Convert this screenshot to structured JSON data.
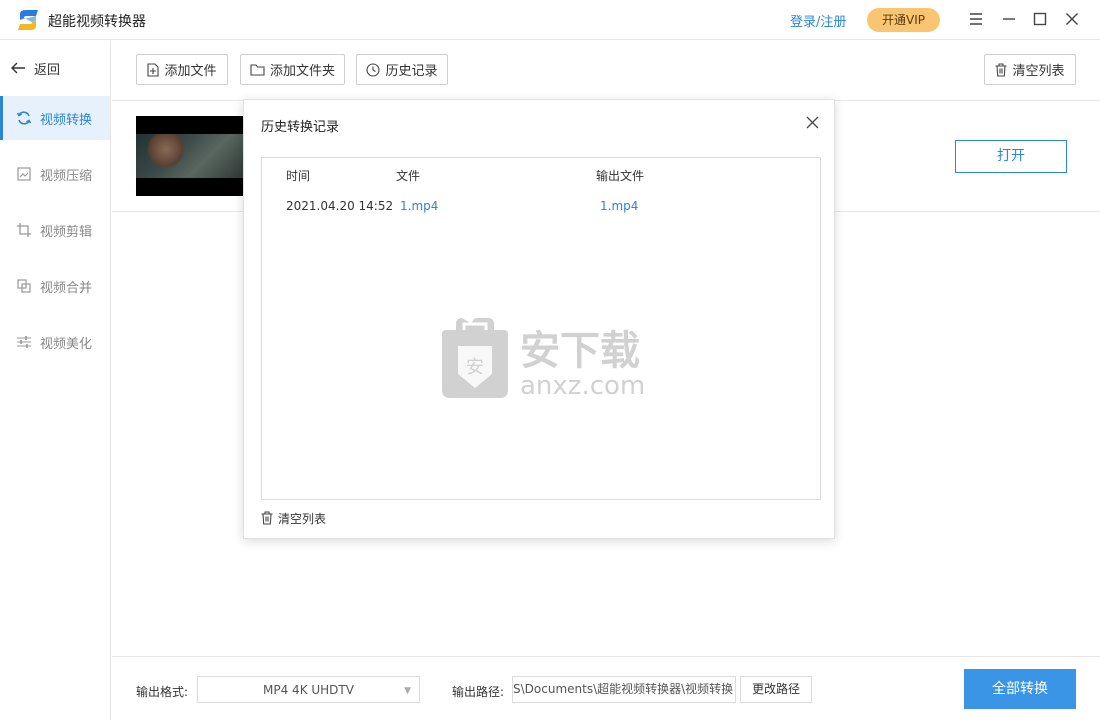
{
  "app": {
    "title": "超能视频转换器",
    "login_label": "登录/注册",
    "vip_label": "开通VIP"
  },
  "sidebar": {
    "back_label": "返回",
    "items": [
      {
        "label": "视频转换",
        "icon": "refresh-icon",
        "active": true
      },
      {
        "label": "视频压缩",
        "icon": "compress-icon",
        "active": false
      },
      {
        "label": "视频剪辑",
        "icon": "crop-icon",
        "active": false
      },
      {
        "label": "视频合并",
        "icon": "merge-icon",
        "active": false
      },
      {
        "label": "视频美化",
        "icon": "sliders-icon",
        "active": false
      }
    ]
  },
  "toolbar": {
    "add_file": "添加文件",
    "add_folder": "添加文件夹",
    "history": "历史记录",
    "clear_list": "清空列表"
  },
  "file_row": {
    "open_label": "打开"
  },
  "bottom": {
    "format_label": "输出格式:",
    "format_value": "MP4 4K UHDTV",
    "path_label": "输出路径:",
    "path_value": "S\\Documents\\超能视频转换器\\视频转换",
    "change_path": "更改路径",
    "convert_all": "全部转换"
  },
  "history_dialog": {
    "title": "历史转换记录",
    "columns": [
      "时间",
      "文件",
      "输出文件"
    ],
    "rows": [
      {
        "time": "2021.04.20 14:52",
        "file": "1.mp4",
        "output": "1.mp4"
      }
    ],
    "clear_label": "清空列表",
    "watermark_text": "安下载",
    "watermark_sub": "anxz.com"
  },
  "colors": {
    "accent": "#2b86d6",
    "vip": "#f9c571",
    "primary_button": "#3b95e6"
  }
}
